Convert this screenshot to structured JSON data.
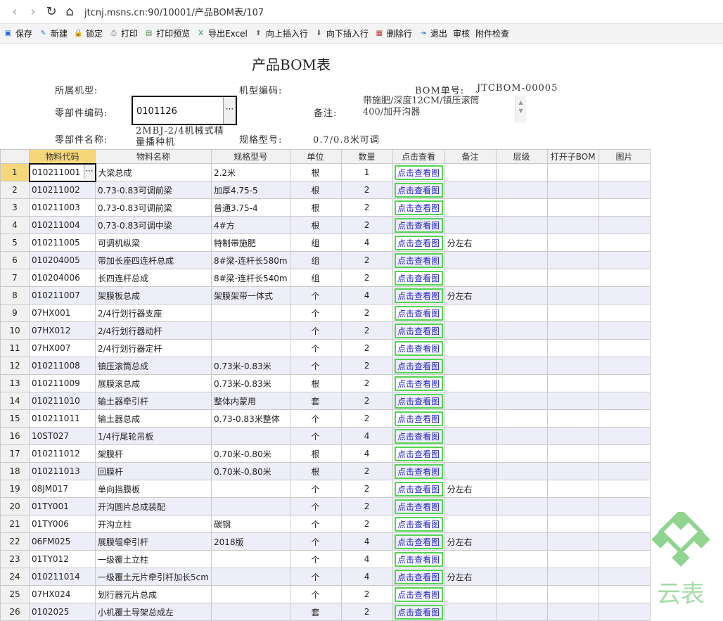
{
  "browser": {
    "url": "jtcnj.msns.cn:90/10001/产品BOM表/107"
  },
  "toolbar": [
    {
      "label": "保存",
      "icon": "save-icon",
      "color": "#2a6ad8"
    },
    {
      "label": "新建",
      "icon": "new-icon",
      "color": "#3a7ad0"
    },
    {
      "label": "锁定",
      "icon": "lock-icon",
      "color": "#e0a020"
    },
    {
      "label": "打印",
      "icon": "print-icon",
      "color": "#5a6a8a"
    },
    {
      "label": "打印预览",
      "icon": "print-preview-icon",
      "color": "#4a8a4a"
    },
    {
      "label": "导出Excel",
      "icon": "excel-icon",
      "color": "#1f8a3a"
    },
    {
      "label": "向上插入行",
      "icon": "insert-up-icon",
      "color": "#666"
    },
    {
      "label": "向下插入行",
      "icon": "insert-down-icon",
      "color": "#666"
    },
    {
      "label": "删除行",
      "icon": "delete-row-icon",
      "color": "#c03030"
    },
    {
      "label": "退出",
      "icon": "exit-icon",
      "color": "#1e6fd8"
    },
    {
      "label": "审核",
      "icon": "",
      "color": ""
    },
    {
      "label": "附件检查",
      "icon": "",
      "color": ""
    }
  ],
  "form": {
    "title": "产品BOM表",
    "model_label": "所属机型:",
    "model_code_label": "机型编码:",
    "bom_no_label": "BOM单号:",
    "bom_no": "JTCBOM-00005",
    "part_code_label": "零部件编码:",
    "part_code": "0101126",
    "remark_label": "备注:",
    "remark_line1": "带施肥/深度12CM/镇压滚筒",
    "remark_line2": "400/加开沟器",
    "part_name_label": "零部件名称:",
    "part_name_line1": "2MBJ-2/4机械式精",
    "part_name_line2": "量播种机",
    "spec_label": "规格型号:",
    "spec": "0.7/0.8米可调"
  },
  "table": {
    "columns": [
      "",
      "物料代码",
      "物料名称",
      "规格型号",
      "单位",
      "数量",
      "点击查看",
      "备注",
      "层级",
      "打开子BOM",
      "图片"
    ],
    "link_text": "点击查看图",
    "rows": [
      {
        "no": "1",
        "code": "010211001",
        "name": "大梁总成",
        "spec": "2.2米",
        "unit": "根",
        "qty": "1",
        "note": ""
      },
      {
        "no": "2",
        "code": "010211002",
        "name": "0.73-0.83可调前梁",
        "spec": "加厚4.75-5",
        "unit": "根",
        "qty": "2",
        "note": ""
      },
      {
        "no": "3",
        "code": "010211003",
        "name": "0.73-0.83可调前梁",
        "spec": "普通3.75-4",
        "unit": "根",
        "qty": "2",
        "note": ""
      },
      {
        "no": "4",
        "code": "010211004",
        "name": "0.73-0.83可调中梁",
        "spec": "4#方",
        "unit": "根",
        "qty": "2",
        "note": ""
      },
      {
        "no": "5",
        "code": "010211005",
        "name": "可调机纵梁",
        "spec": "特制带施肥",
        "unit": "组",
        "qty": "4",
        "note": "分左右"
      },
      {
        "no": "6",
        "code": "010204005",
        "name": "带加长座四连杆总成",
        "spec": "8#梁-连杆长580m",
        "unit": "组",
        "qty": "2",
        "note": ""
      },
      {
        "no": "7",
        "code": "010204006",
        "name": "长四连杆总成",
        "spec": "8#梁-连杆长540m",
        "unit": "组",
        "qty": "2",
        "note": ""
      },
      {
        "no": "8",
        "code": "010211007",
        "name": "架膜板总成",
        "spec": "架膜架带一体式",
        "unit": "个",
        "qty": "4",
        "note": "分左右"
      },
      {
        "no": "9",
        "code": "07HX001",
        "name": "2/4行划行器支座",
        "spec": "",
        "unit": "个",
        "qty": "2",
        "note": ""
      },
      {
        "no": "10",
        "code": "07HX012",
        "name": "2/4行划行器动杆",
        "spec": "",
        "unit": "个",
        "qty": "2",
        "note": ""
      },
      {
        "no": "11",
        "code": "07HX007",
        "name": "2/4行划行器定杆",
        "spec": "",
        "unit": "个",
        "qty": "2",
        "note": ""
      },
      {
        "no": "12",
        "code": "010211008",
        "name": "镇压滚筒总成",
        "spec": "0.73米-0.83米",
        "unit": "个",
        "qty": "2",
        "note": ""
      },
      {
        "no": "13",
        "code": "010211009",
        "name": "展膜滚总成",
        "spec": "0.73米-0.83米",
        "unit": "根",
        "qty": "2",
        "note": ""
      },
      {
        "no": "14",
        "code": "010211010",
        "name": "输土器牵引杆",
        "spec": "整体内蒙用",
        "unit": "套",
        "qty": "2",
        "note": ""
      },
      {
        "no": "15",
        "code": "010211011",
        "name": "输土器总成",
        "spec": "0.73-0.83米整体",
        "unit": "个",
        "qty": "2",
        "note": ""
      },
      {
        "no": "16",
        "code": "10ST027",
        "name": "1/4行尾轮吊板",
        "spec": "",
        "unit": "个",
        "qty": "4",
        "note": ""
      },
      {
        "no": "17",
        "code": "010211012",
        "name": "架膜杆",
        "spec": "0.70米-0.80米",
        "unit": "根",
        "qty": "4",
        "note": ""
      },
      {
        "no": "18",
        "code": "010211013",
        "name": "回膜杆",
        "spec": "0.70米-0.80米",
        "unit": "根",
        "qty": "2",
        "note": ""
      },
      {
        "no": "19",
        "code": "08JM017",
        "name": "单向挡膜板",
        "spec": "",
        "unit": "个",
        "qty": "2",
        "note": "分左右"
      },
      {
        "no": "20",
        "code": "01TY001",
        "name": "开沟圆片总成装配",
        "spec": "",
        "unit": "个",
        "qty": "2",
        "note": ""
      },
      {
        "no": "21",
        "code": "01TY006",
        "name": "开沟立柱",
        "spec": "碳钢",
        "unit": "个",
        "qty": "2",
        "note": ""
      },
      {
        "no": "22",
        "code": "06FM025",
        "name": "展膜辊牵引杆",
        "spec": "2018版",
        "unit": "个",
        "qty": "4",
        "note": "分左右"
      },
      {
        "no": "23",
        "code": "01TY012",
        "name": "一级覆土立柱",
        "spec": "",
        "unit": "个",
        "qty": "4",
        "note": ""
      },
      {
        "no": "24",
        "code": "010211014",
        "name": "一级覆土元片牵引杆加长5cm",
        "spec": "",
        "unit": "个",
        "qty": "4",
        "note": "分左右"
      },
      {
        "no": "25",
        "code": "07HX024",
        "name": "划行器元片总成",
        "spec": "",
        "unit": "个",
        "qty": "2",
        "note": ""
      },
      {
        "no": "26",
        "code": "0102025",
        "name": "小机覆土导架总成左",
        "spec": "",
        "unit": "套",
        "qty": "2",
        "note": ""
      }
    ]
  },
  "watermark": {
    "text": "云表",
    "color": "#7cc97c"
  }
}
